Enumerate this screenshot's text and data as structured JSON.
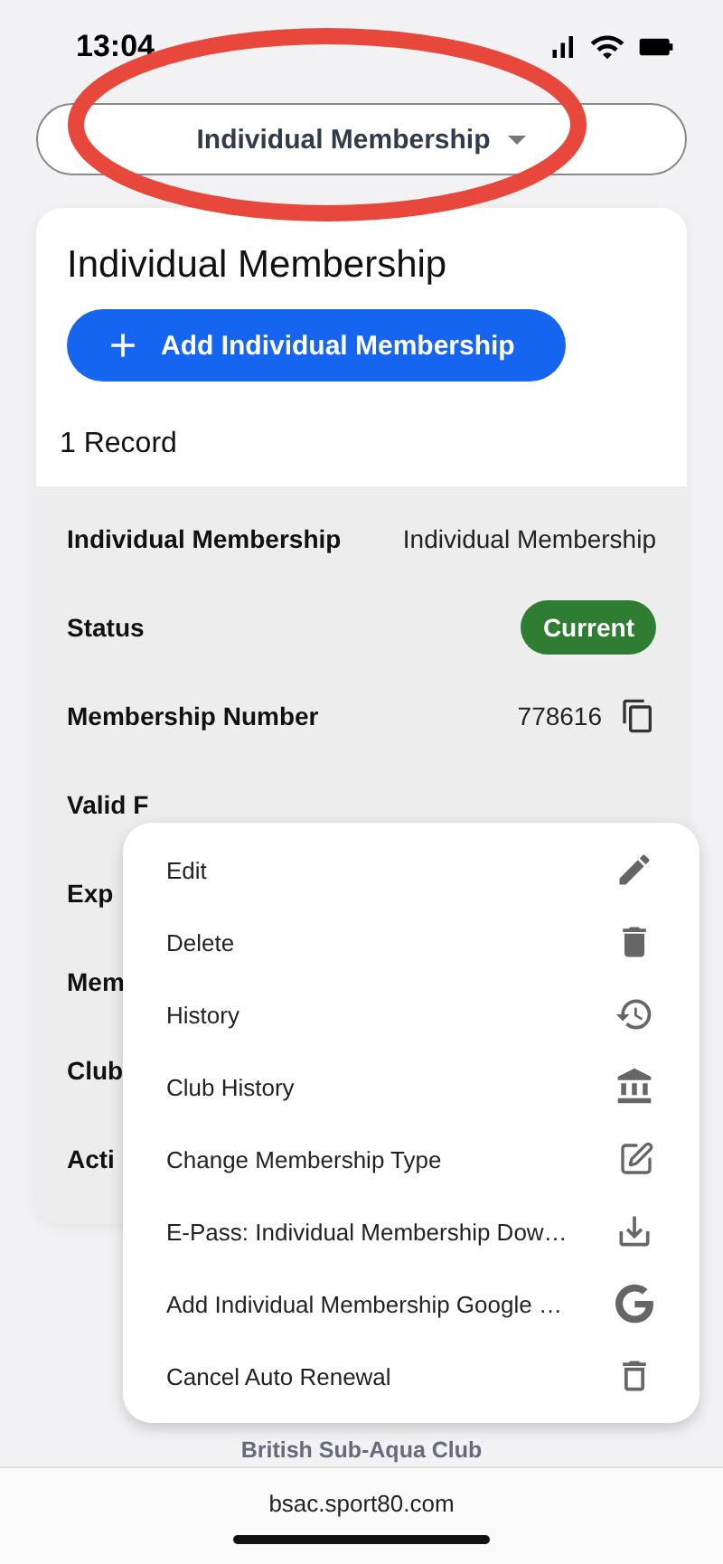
{
  "status_bar": {
    "time": "13:04"
  },
  "selector": {
    "label": "Individual Membership"
  },
  "card": {
    "title": "Individual Membership",
    "add_button": "Add Individual Membership",
    "record_count": "1 Record",
    "rows": [
      {
        "kind": "text",
        "label": "Individual Membership",
        "value": "Individual Membership"
      },
      {
        "kind": "badge",
        "label": "Status",
        "value": "Current"
      },
      {
        "kind": "copy",
        "label": "Membership Number",
        "value": "778616"
      },
      {
        "kind": "plain",
        "label": "Valid F"
      },
      {
        "kind": "plain",
        "label": "Exp"
      },
      {
        "kind": "plain",
        "label": "Mem"
      },
      {
        "kind": "plain",
        "label": "Club"
      },
      {
        "kind": "plain",
        "label": "Acti"
      }
    ]
  },
  "menu": {
    "items": [
      "Edit",
      "Delete",
      "History",
      "Club History",
      "Change Membership Type",
      "E-Pass: Individual Membership Dow…",
      "Add Individual Membership Google …",
      "Cancel Auto Renewal"
    ]
  },
  "footer": "British Sub-Aqua Club",
  "url_bar": "bsac.sport80.com"
}
